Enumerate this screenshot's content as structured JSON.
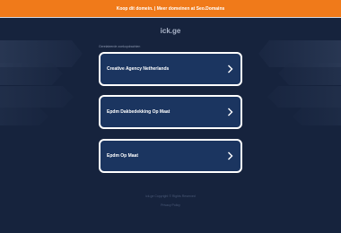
{
  "banner": {
    "text": "Koop dit domein. | Meer domeinen at Seo.Domains"
  },
  "site": {
    "domain": "ick.ge"
  },
  "related": {
    "heading": "Gerelateerde zoekopdrachten",
    "items": [
      {
        "label": "Creative Agency Netherlands"
      },
      {
        "label": "Epdm Dakbedekking Op Maat"
      },
      {
        "label": "Epdm Op Maat"
      }
    ]
  },
  "footer": {
    "copyright": "ick.ge Copyright © Rights Reserved",
    "privacy": "Privacy Policy"
  },
  "colors": {
    "background": "#16233d",
    "banner": "#f07a1a",
    "button_fill": "#1b3560",
    "button_border": "#ffffff"
  },
  "icons": {
    "button_arrow": "chevron-right-icon"
  }
}
